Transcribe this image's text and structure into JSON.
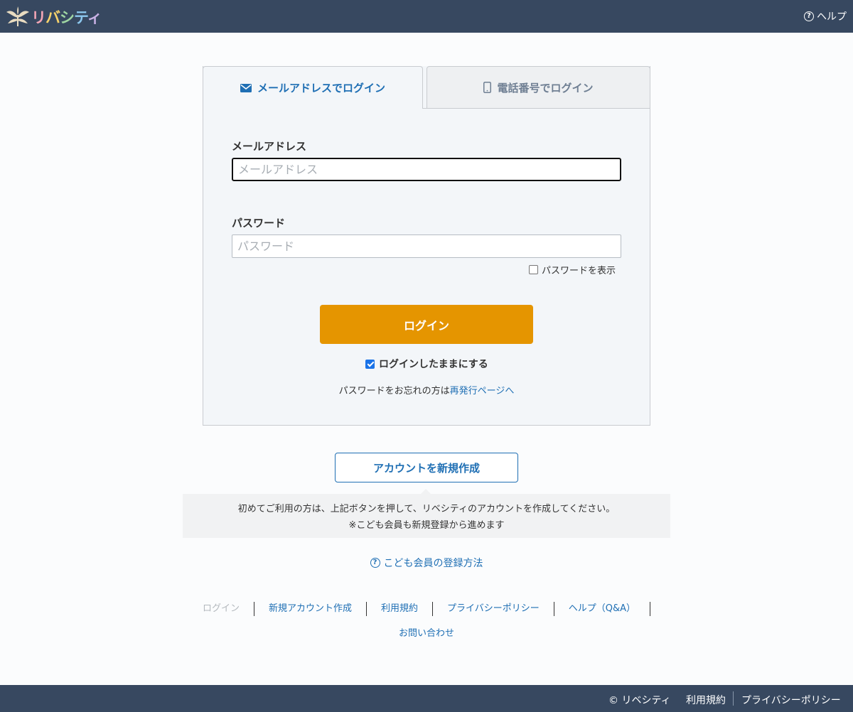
{
  "header": {
    "logo_text": [
      "リ",
      "バ",
      "シ",
      "テ",
      "ィ"
    ],
    "help_label": "ヘルプ"
  },
  "tabs": {
    "email": {
      "label": "メールアドレスでログイン",
      "icon": "envelope-icon",
      "active": true
    },
    "phone": {
      "label": "電話番号でログイン",
      "icon": "mobile-phone-icon",
      "active": false
    }
  },
  "form": {
    "email_label": "メールアドレス",
    "email_placeholder": "メールアドレス",
    "email_value": "",
    "password_label": "パスワード",
    "password_placeholder": "パスワード",
    "password_value": "",
    "show_password_label": "パスワードを表示",
    "show_password_checked": false,
    "login_button": "ログイン",
    "remember_label": "ログインしたままにする",
    "remember_checked": true,
    "forgot_text": "パスワードをお忘れの方は",
    "forgot_link": "再発行ページへ"
  },
  "signup": {
    "create_button": "アカウントを新規作成",
    "notice_line1": "初めてご利用の方は、上記ボタンを押して、リベシティのアカウントを作成してください。",
    "notice_line2": "※こども会員も新規登録から進めます",
    "kids_link": "こども会員の登録方法"
  },
  "footer_nav": {
    "items": [
      "ログイン",
      "新規アカウント作成",
      "利用規約",
      "プライバシーポリシー",
      "ヘルプ（Q&A）"
    ],
    "current": "ログイン",
    "contact": "お問い合わせ"
  },
  "bottom_bar": {
    "copyright": "© リベシティ",
    "terms": "利用規約",
    "privacy": "プライバシーポリシー"
  },
  "colors": {
    "header_bg": "#374860",
    "accent_blue": "#1f6fb4",
    "login_button": "#e59500",
    "card_bg": "#f3f6f9"
  }
}
